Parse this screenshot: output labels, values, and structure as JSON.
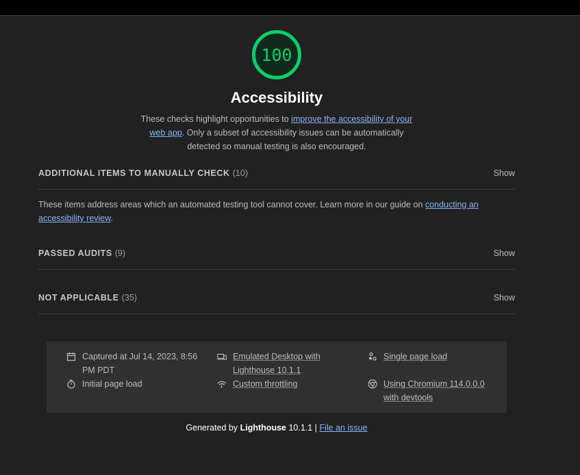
{
  "score": "100",
  "category": {
    "title": "Accessibility",
    "desc_before": "These checks highlight opportunities to ",
    "desc_link": "improve the accessibility of your web app",
    "desc_after": ". Only a subset of accessibility issues can be automatically detected so manual testing is also encouraged."
  },
  "groups": [
    {
      "title": "Additional items to manually check",
      "count": "(10)",
      "show": "Show",
      "desc_before": "These items address areas which an automated testing tool cannot cover. Learn more in our guide on ",
      "desc_link": "conducting an accessibility review",
      "desc_after": "."
    },
    {
      "title": "Passed audits",
      "count": "(9)",
      "show": "Show"
    },
    {
      "title": "Not applicable",
      "count": "(35)",
      "show": "Show"
    }
  ],
  "footer": {
    "captured": "Captured at Jul 14, 2023, 8:56 PM PDT",
    "initial_load": "Initial page load",
    "emulated": "Emulated Desktop with Lighthouse 10.1.1",
    "throttling": "Custom throttling",
    "single_load": "Single page load",
    "chromium": "Using Chromium 114.0.0.0 with devtools"
  },
  "generated": {
    "prefix": "Generated by ",
    "product": "Lighthouse",
    "version": " 10.1.1 | ",
    "issue_link": "File an issue"
  },
  "colors": {
    "pass": "#0cce6b",
    "link": "#8ab4f8",
    "background": "#212121"
  }
}
